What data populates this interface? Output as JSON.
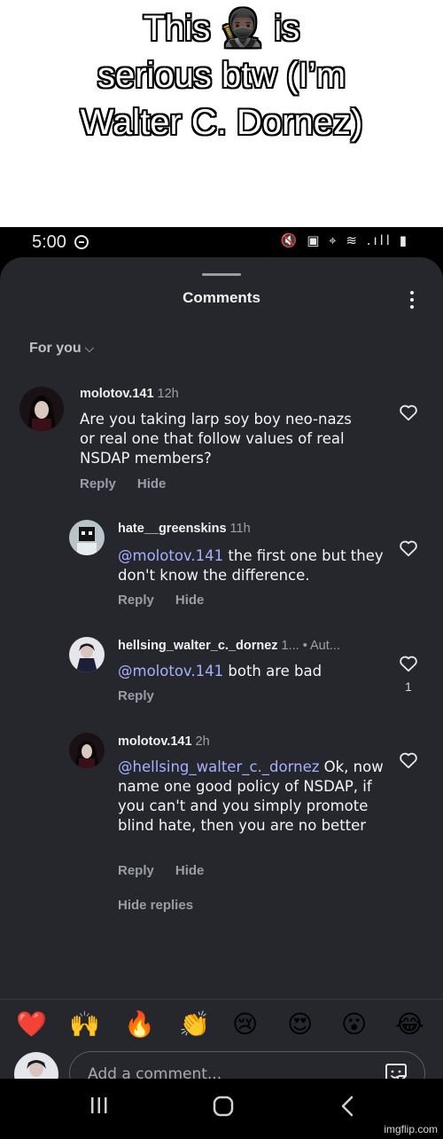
{
  "caption": {
    "lines": [
      "This 🥷🏿 is",
      "serious btw (I’m",
      "Walter C. Dornez)"
    ]
  },
  "status_bar": {
    "time": "5:00",
    "icons": "🔇 ▣ ⌖ ≋ .ıll ▮"
  },
  "sheet": {
    "title": "Comments",
    "filter_label": "For you",
    "filter_chevron": "⌵"
  },
  "comments": [
    {
      "username": "molotov.141",
      "meta": "12h",
      "text": "Are you taking larp soy boy neo-nazs or real one that follow values of real NSDAP members?",
      "mention": "",
      "reply_label": "Reply",
      "hide_label": "Hide",
      "like_count": ""
    },
    {
      "username": "hate__greenskins",
      "meta": "11h",
      "mention": "@molotov.141",
      "text": " the first one but they don't know the difference.",
      "reply_label": "Reply",
      "hide_label": "Hide",
      "like_count": ""
    },
    {
      "username": "hellsing_walter_c._dornez",
      "meta": "1... • Aut...",
      "mention": "@molotov.141",
      "text": " both are bad",
      "reply_label": "Reply",
      "hide_label": "",
      "like_count": "1"
    },
    {
      "username": "molotov.141",
      "meta": "2h",
      "mention": "@hellsing_walter_c._dornez",
      "text": " Ok, now name one good policy of NSDAP, if you can't and you simply promote blind hate, then you are no better",
      "reply_label": "Reply",
      "hide_label": "Hide",
      "like_count": ""
    }
  ],
  "hide_replies_label": "Hide replies",
  "reactions": [
    "❤️",
    "🙌",
    "🔥",
    "👏",
    "😢",
    "😍",
    "😮",
    "😂"
  ],
  "composer": {
    "placeholder": "Add a comment..."
  },
  "watermark": "imgflip.com",
  "colors": {
    "sheet_bg": "#25272d",
    "mention": "#a7b0ff",
    "muted": "#9a9da4"
  },
  "icons": {
    "like": "heart-outline-icon",
    "more": "vertical-dots-icon",
    "sticker": "sticker-icon",
    "nav_recents": "recents-icon",
    "nav_home": "home-icon",
    "nav_back": "back-icon"
  }
}
